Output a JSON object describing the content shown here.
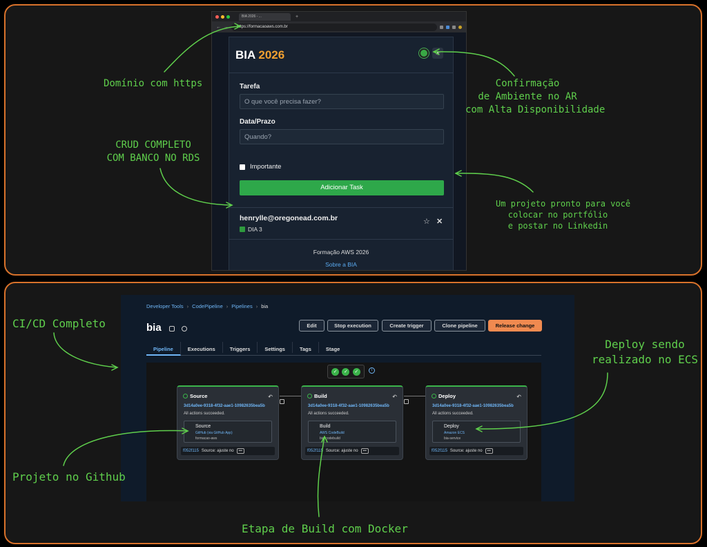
{
  "browser": {
    "tab_title": "BIA 2026 - ...",
    "url": "https://formacaoaws.com.br"
  },
  "app": {
    "title_main": "BIA",
    "title_year": "2026",
    "task_label": "Tarefa",
    "task_placeholder": "O que você precisa fazer?",
    "date_label": "Data/Prazo",
    "date_placeholder": "Quando?",
    "important_label": "Importante",
    "add_button": "Adicionar Task",
    "task_item": {
      "email": "henrylle@oregonead.com.br",
      "tag": "DIA 3"
    },
    "footer_text": "Formação AWS 2026",
    "footer_link": "Sobre a BIA"
  },
  "console": {
    "breadcrumbs": [
      "Developer Tools",
      "CodePipeline",
      "Pipelines",
      "bia"
    ],
    "pipeline_name": "bia",
    "buttons": [
      "Edit",
      "Stop execution",
      "Create trigger",
      "Clone pipeline",
      "Release change"
    ],
    "tabs": [
      "Pipeline",
      "Executions",
      "Triggers",
      "Settings",
      "Tags",
      "Stage"
    ],
    "stages": [
      {
        "name": "Source",
        "exec_id": "3d14a0ee-9318-4f32-aae1-10982635bea5b",
        "status": "All actions succeeded.",
        "action_name": "Source",
        "provider": "GitHub (via GitHub App)",
        "resource": "formacao-aws",
        "commit": "f052f115",
        "commit_msg": "Source: ajuste no"
      },
      {
        "name": "Build",
        "exec_id": "3d14a0ee-9318-4f32-aae1-10982635bea5b",
        "status": "All actions succeeded.",
        "action_name": "Build",
        "provider": "AWS CodeBuild",
        "resource": "bia-codebuild",
        "commit": "f052f115",
        "commit_msg": "Source: ajuste no"
      },
      {
        "name": "Deploy",
        "exec_id": "3d14a0ee-9318-4f32-aae1-10982635bea5b",
        "status": "All actions succeeded.",
        "action_name": "Deploy",
        "provider": "Amazon ECS",
        "resource": "bia-service",
        "commit": "f052f115",
        "commit_msg": "Source: ajuste no"
      }
    ]
  },
  "annotations": {
    "domain": "Domínio com https",
    "crud_1": "CRUD COMPLETO",
    "crud_2": "COM BANCO NO RDS",
    "confirm_1": "Confirmação",
    "confirm_2": "de Ambiente no AR",
    "confirm_3": "com Alta Disponibilidade",
    "project_1": "Um projeto pronto para você",
    "project_2": "colocar no portfólio",
    "project_3": "e postar no Linkedin",
    "cicd": "CI/CD Completo",
    "deploy_1": "Deploy sendo",
    "deploy_2": "realizado no ECS",
    "github": "Projeto no Github",
    "build": "Etapa de Build com Docker"
  },
  "colors": {
    "frame": "#d9722b",
    "annotation": "#5fcf4c",
    "success": "#2ea84a",
    "accent_year": "#f0a030",
    "release": "#f08a50",
    "link": "#6fb5f5"
  }
}
